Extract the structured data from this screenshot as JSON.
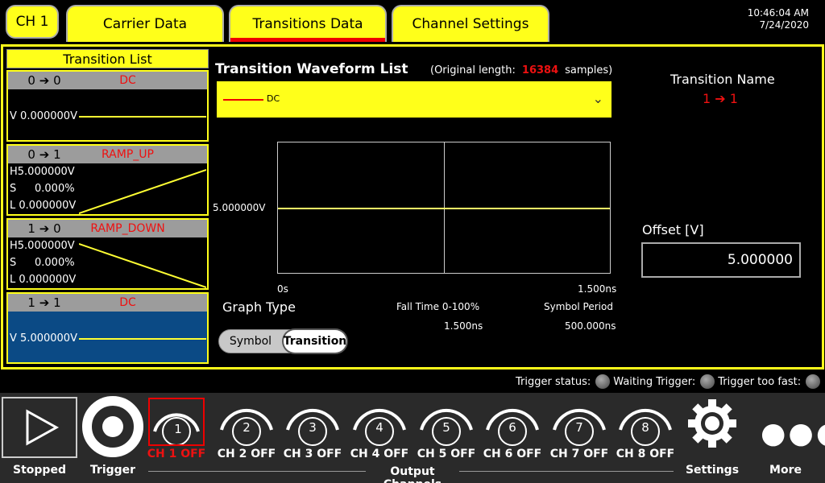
{
  "channel_button": "CH 1",
  "tabs": [
    {
      "label": "Carrier Data"
    },
    {
      "label": "Transitions Data"
    },
    {
      "label": "Channel Settings"
    }
  ],
  "clock": {
    "time": "10:46:04 AM",
    "date": "7/24/2020"
  },
  "transition_list": {
    "title": "Transition List",
    "items": [
      {
        "from": "0",
        "to": "0",
        "arrow": "➔",
        "type": "DC",
        "v_label": "V",
        "v_value": "0.000000V"
      },
      {
        "from": "0",
        "to": "1",
        "arrow": "➔",
        "type": "RAMP_UP",
        "h": "5.000000V",
        "s": "0.000%",
        "l": "0.000000V"
      },
      {
        "from": "1",
        "to": "0",
        "arrow": "➔",
        "type": "RAMP_DOWN",
        "h": "5.000000V",
        "s": "0.000%",
        "l": "0.000000V"
      },
      {
        "from": "1",
        "to": "1",
        "arrow": "➔",
        "type": "DC",
        "v_label": "V",
        "v_value": "5.000000V"
      }
    ],
    "row_labels": {
      "h": "H",
      "s": "S",
      "l": "L"
    }
  },
  "waveform": {
    "title": "Transition Waveform List",
    "orig_prefix": "(Original length:",
    "orig_count": "16384",
    "orig_suffix": "samples)",
    "selected": "DC",
    "y_label": "5.000000V",
    "x_start": "0s",
    "x_end": "1.500ns"
  },
  "graph_type": {
    "label": "Graph Type",
    "options": [
      "Symbol",
      "Transition"
    ],
    "selected": "Transition"
  },
  "fall_time": {
    "label": "Fall Time 0-100%",
    "value": "1.500ns"
  },
  "symbol_period": {
    "label": "Symbol Period",
    "value": "500.000ns"
  },
  "transition_name": {
    "label": "Transition Name",
    "value": "1 ➔ 1"
  },
  "offset": {
    "label": "Offset [V]",
    "value": "5.000000"
  },
  "trigger_status": {
    "status_label": "Trigger status:",
    "waiting_label": "Waiting Trigger:",
    "too_fast_label": "Trigger too fast:"
  },
  "bottom": {
    "stopped": "Stopped",
    "trigger": "Trigger",
    "output_channels": "Output Channels",
    "settings": "Settings",
    "more": "More",
    "channels": [
      {
        "num": "1",
        "label": "CH 1 OFF",
        "selected": true
      },
      {
        "num": "2",
        "label": "CH 2 OFF"
      },
      {
        "num": "3",
        "label": "CH 3 OFF"
      },
      {
        "num": "4",
        "label": "CH 4 OFF"
      },
      {
        "num": "5",
        "label": "CH 5 OFF"
      },
      {
        "num": "6",
        "label": "CH 6 OFF"
      },
      {
        "num": "7",
        "label": "CH 7 OFF"
      },
      {
        "num": "8",
        "label": "CH 8 OFF"
      }
    ]
  },
  "colors": {
    "accent": "#ffff1a",
    "alert": "#e11111",
    "selected_item": "#0b4a85"
  }
}
